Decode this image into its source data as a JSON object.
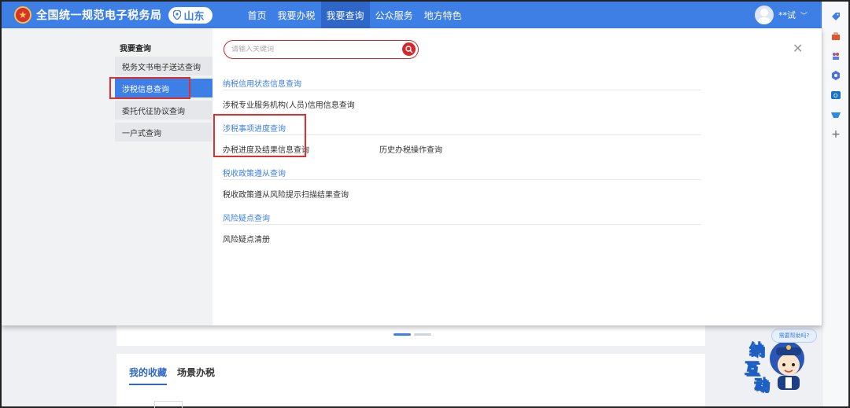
{
  "header": {
    "logo_icon": "tax-emblem-icon",
    "title": "全国统一规范电子税务局",
    "region": "山东",
    "nav": [
      "首页",
      "我要办税",
      "我要查询",
      "公众服务",
      "地方特色"
    ],
    "active_nav": "我要查询",
    "user_name": "**试"
  },
  "menu": {
    "title": "我要查询",
    "items": [
      "税务文书电子送达查询",
      "涉税信息查询",
      "委托代征协议查询",
      "一户式查询"
    ],
    "active_item": "涉税信息查询"
  },
  "search": {
    "placeholder": "请输入关键词"
  },
  "sections": [
    {
      "title": "纳税信用状态信息查询",
      "links": [
        "涉税专业服务机构(人员)信用信息查询"
      ]
    },
    {
      "title": "涉税事项进度查询",
      "links": [
        "办税进度及结果信息查询",
        "历史办税操作查询"
      ]
    },
    {
      "title": "税收政策遵从查询",
      "links": [
        "税收政策遵从风险提示扫描结果查询"
      ]
    },
    {
      "title": "风险疑点查询",
      "links": [
        "风险疑点清册"
      ]
    }
  ],
  "background": {
    "tabs": [
      "我的收藏",
      "场景办税"
    ]
  },
  "assistant": {
    "bubble": "需要帮助吗?",
    "chars": [
      "纳",
      "互",
      "动"
    ]
  },
  "colors": {
    "primary": "#3e7fe6",
    "highlight_red": "#e0302c"
  }
}
